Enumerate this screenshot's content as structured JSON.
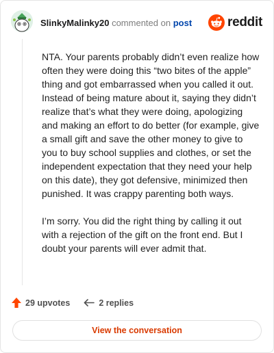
{
  "header": {
    "username": "SlinkyMalinky20",
    "action_text": "commented on",
    "post_link": "post",
    "brand": "reddit"
  },
  "comment": {
    "paragraphs": [
      "NTA. Your parents probably didn’t even realize how often they were doing this “two bites of the apple” thing and got embarrassed when you called it out. Instead of being mature about it, saying they didn’t realize that’s what they were doing, apologizing and making an effort to do better (for example, give a small gift and save the other money to give to you to buy school supplies and clothes, or set the independent expectation that they need your help on this date), they got defensive, minimized then punished. It was crappy parenting both ways.",
      "I’m sorry. You did the right thing by calling it out with a rejection of the gift on the front end. But I doubt your parents will ever admit that."
    ]
  },
  "actions": {
    "upvotes": "29 upvotes",
    "replies": "2 replies"
  },
  "view_button": "View the conversation",
  "colors": {
    "accent": "#ff4500",
    "link": "#0045ac",
    "button_text": "#d93a00"
  },
  "icons": [
    "avatar",
    "reddit-logo-icon",
    "upvote-arrow-icon",
    "reply-arrow-icon"
  ]
}
